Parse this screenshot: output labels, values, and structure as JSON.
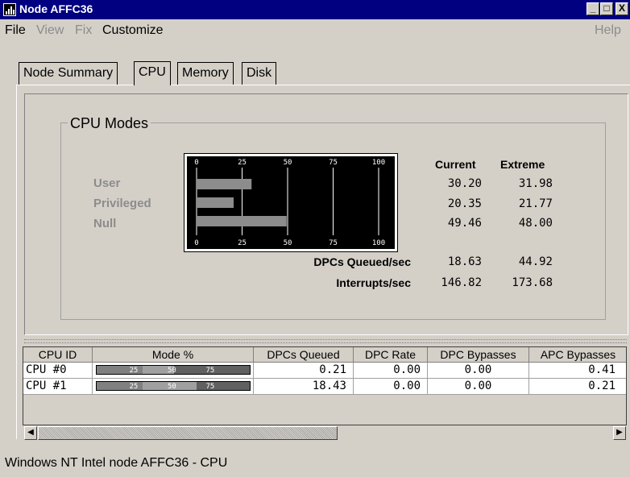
{
  "window": {
    "title": "Node AFFC36",
    "min_label": "_",
    "max_label": "□",
    "close_label": "X"
  },
  "menu": {
    "file": "File",
    "view": "View",
    "fix": "Fix",
    "customize": "Customize",
    "help": "Help"
  },
  "tabs": [
    {
      "label": "Node Summary",
      "active": false
    },
    {
      "label": "CPU",
      "active": true
    },
    {
      "label": "Memory",
      "active": false
    },
    {
      "label": "Disk",
      "active": false
    }
  ],
  "cpu_modes": {
    "group_label": "CPU Modes",
    "labels": [
      "User",
      "Privileged",
      "Null"
    ],
    "graph": {
      "scale_ticks": [
        "0",
        "25",
        "50",
        "75",
        "100"
      ],
      "bars_percent": [
        30.2,
        20.35,
        49.46
      ],
      "bar_color": "#8c8c8c"
    },
    "column_headers": {
      "current": "Current",
      "extreme": "Extreme"
    },
    "rows": [
      {
        "current": "30.20",
        "extreme": "31.98"
      },
      {
        "current": "20.35",
        "extreme": "21.77"
      },
      {
        "current": "49.46",
        "extreme": "48.00"
      }
    ],
    "dpcs": {
      "label": "DPCs Queued/sec",
      "current": "18.63",
      "extreme": "44.92"
    },
    "interrupts": {
      "label": "Interrupts/sec",
      "current": "146.82",
      "extreme": "173.68"
    }
  },
  "cpu_table": {
    "headers": [
      "CPU ID",
      "Mode %",
      "DPCs Queued",
      "DPC Rate",
      "DPC Bypasses",
      "APC Bypasses"
    ],
    "mode_ticks": [
      "25",
      "50",
      "75"
    ],
    "rows": [
      {
        "id": "CPU #0",
        "mode_bars_percent": [
          30.2,
          20.35,
          49.45
        ],
        "dpcs_queued": "0.21",
        "dpc_rate": "0.00",
        "dpc_bypasses": "0.00",
        "apc_bypasses": "0.41"
      },
      {
        "id": "CPU #1",
        "mode_bars_percent": [
          30.2,
          35.0,
          34.8
        ],
        "dpcs_queued": "18.43",
        "dpc_rate": "0.00",
        "dpc_bypasses": "0.00",
        "apc_bypasses": "0.21"
      }
    ]
  },
  "scrollbar": {
    "left_arrow": "◀",
    "right_arrow": "▶"
  },
  "status": "Windows NT Intel node AFFC36 - CPU"
}
